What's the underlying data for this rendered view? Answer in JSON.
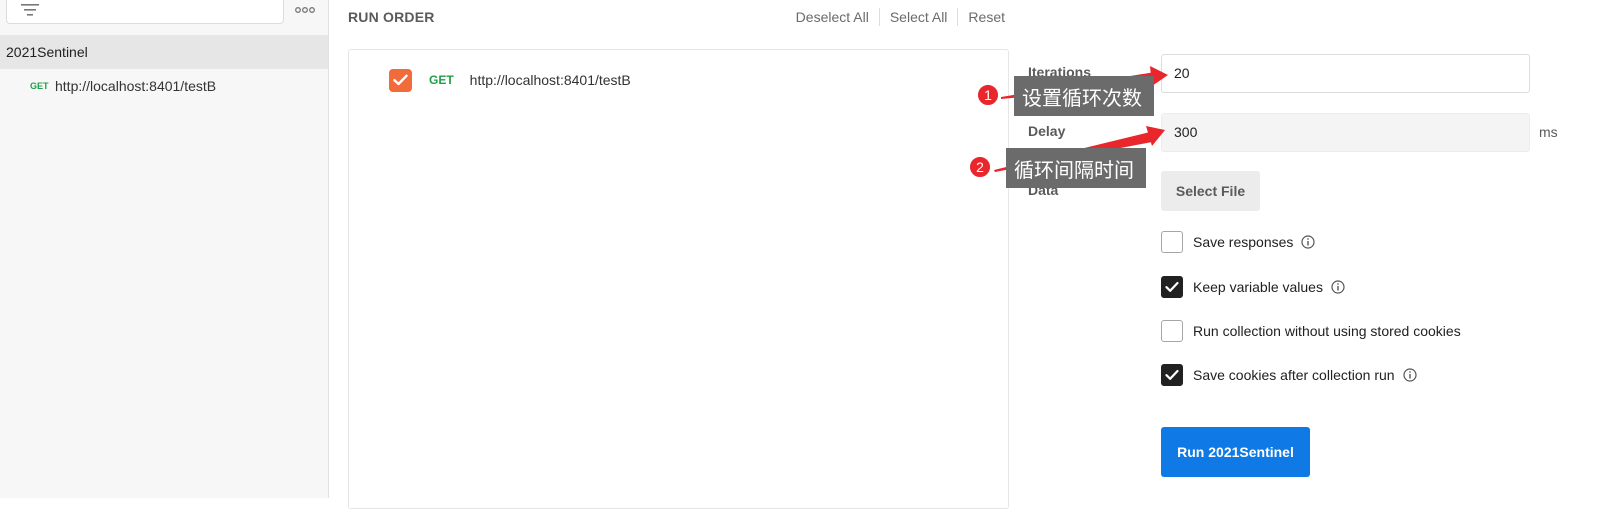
{
  "sidebar": {
    "collection_name": "2021Sentinel",
    "request": {
      "method": "GET",
      "url": "http://localhost:8401/testB"
    }
  },
  "run_order": {
    "title": "RUN ORDER",
    "deselect_all": "Deselect All",
    "select_all": "Select All",
    "reset": "Reset",
    "items": [
      {
        "checked": true,
        "method": "GET",
        "url": "http://localhost:8401/testB"
      }
    ]
  },
  "settings": {
    "iterations_label": "Iterations",
    "iterations_value": "20",
    "delay_label": "Delay",
    "delay_value": "300",
    "delay_unit": "ms",
    "data_label": "Data",
    "select_file": "Select File",
    "options": [
      {
        "label": "Save responses",
        "checked": false,
        "info": true
      },
      {
        "label": "Keep variable values",
        "checked": true,
        "info": true
      },
      {
        "label": "Run collection without using stored cookies",
        "checked": false,
        "info": false
      },
      {
        "label": "Save cookies after collection run",
        "checked": true,
        "info": true
      }
    ],
    "run_button": "Run 2021Sentinel"
  },
  "annotations": [
    {
      "number": "1",
      "text": "设置循环次数"
    },
    {
      "number": "2",
      "text": "循环间隔时间"
    }
  ],
  "colors": {
    "accent": "#0f7ae5",
    "method_get": "#1ea04a",
    "checkbox_orange": "#f26b3a",
    "annotation_red": "#e8262c",
    "callout_bg": "#6b6b6b"
  },
  "icons": [
    "filter-icon",
    "more-icon",
    "checkmark-icon",
    "info-icon"
  ]
}
